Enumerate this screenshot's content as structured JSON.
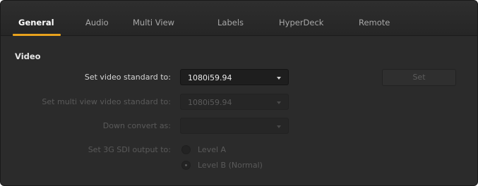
{
  "tabs": [
    {
      "label": "General",
      "active": true
    },
    {
      "label": "Audio"
    },
    {
      "label": "Multi View"
    },
    {
      "label": "Labels"
    },
    {
      "label": "HyperDeck"
    },
    {
      "label": "Remote"
    }
  ],
  "section": {
    "title": "Video"
  },
  "video_standard": {
    "label": "Set video standard to:",
    "value": "1080i59.94"
  },
  "set_button": {
    "label": "Set"
  },
  "multi_view_standard": {
    "label": "Set multi view video standard to:",
    "value": "1080i59.94"
  },
  "down_convert": {
    "label": "Down convert as:",
    "value": ""
  },
  "sdi_output": {
    "label": "Set 3G SDI output to:",
    "options": [
      {
        "label": "Level A",
        "checked": false
      },
      {
        "label": "Level B (Normal)",
        "checked": true
      }
    ]
  },
  "colors": {
    "accent": "#e8a21d",
    "background": "#2b2b2b"
  }
}
